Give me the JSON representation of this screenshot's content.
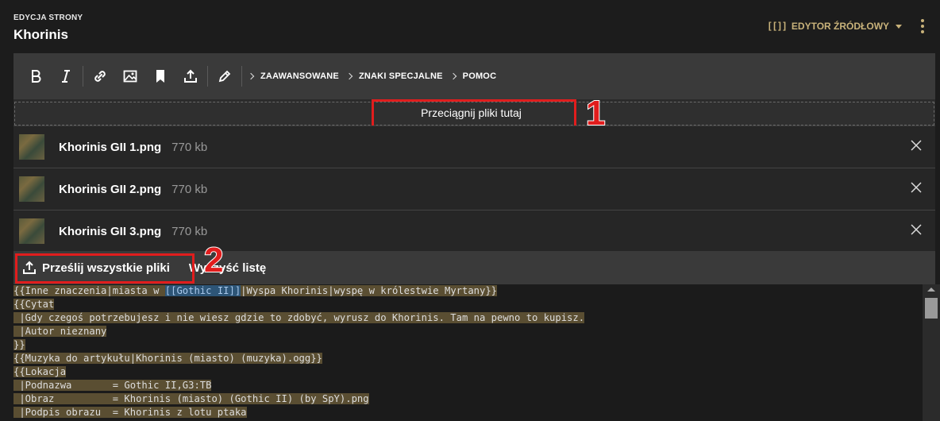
{
  "header": {
    "kicker": "EDYCJA STRONY",
    "title": "Khorinis",
    "mode_switch": {
      "icon": "[[]]",
      "label": "EDYTOR ŹRÓDŁOWY"
    }
  },
  "toolbar": {
    "buttons": [
      "bold-icon",
      "italic-icon",
      "link-icon",
      "image-icon",
      "bookmark-icon",
      "upload-icon",
      "pencil-icon"
    ],
    "sections": [
      "ZAAWANSOWANE",
      "ZNAKI SPECJALNE",
      "POMOC"
    ]
  },
  "dropzone": {
    "label": "Przeciągnij pliki tutaj"
  },
  "files": [
    {
      "name": "Khorinis GII 1.png",
      "size": "770 kb"
    },
    {
      "name": "Khorinis GII 2.png",
      "size": "770 kb"
    },
    {
      "name": "Khorinis GII 3.png",
      "size": "770 kb"
    }
  ],
  "actions": {
    "upload_all": "Prześlij wszystkie pliki",
    "clear_list": "Wyczyść listę"
  },
  "annotations": {
    "one": "1",
    "two": "2"
  },
  "source_lines": [
    "{{Inne znaczenia|miasta w ",
    "{{Cytat",
    " |Gdy czegoś potrzebujesz i nie wiesz gdzie to zdobyć, wyrusz do Khorinis. Tam na pewno to kupisz.",
    " |Autor nieznany",
    "}}",
    "{{Muzyka do artykułu|Khorinis (miasto) (muzyka).ogg}}",
    "{{Lokacja",
    " |Podnazwa       = Gothic II,G3:TB",
    " |Obraz          = Khorinis (miasto) (Gothic II) (by SpY).png",
    " |Podpis obrazu  = Khorinis z lotu ptaka"
  ],
  "source_link": "[[Gothic II]]",
  "source_line1_rest": "|Wyspa Khorinis|wyspę w królestwie Myrtany}}",
  "colors": {
    "accent": "#c8b27a",
    "annotation_red": "#e11d1d",
    "highlight": "#5a4e32"
  }
}
